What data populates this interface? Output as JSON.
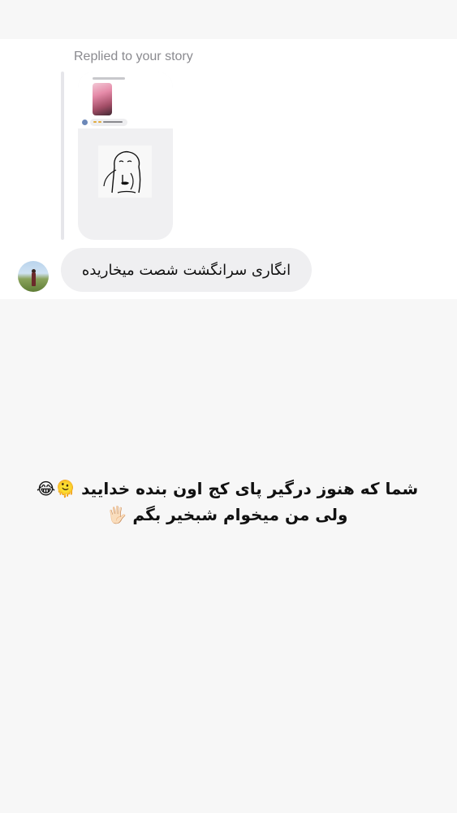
{
  "reply": {
    "label": "Replied to your story"
  },
  "message": {
    "text": "انگاری سرانگشت شصت میخاریده"
  },
  "caption": {
    "line1": "شما که هنوز درگیر پای کج اون بنده خدایید 🫠😂",
    "line2": "ولی من میخوام شبخیر بگم 🖐🏻"
  },
  "icons": {
    "avatar": "profile-photo-avatar",
    "doodle": "meme-doodle-sticker"
  },
  "colors": {
    "page_background": "#f7f7f7",
    "bubble": "#efeff1",
    "label_gray": "#8a8a8f",
    "text": "#111111"
  }
}
